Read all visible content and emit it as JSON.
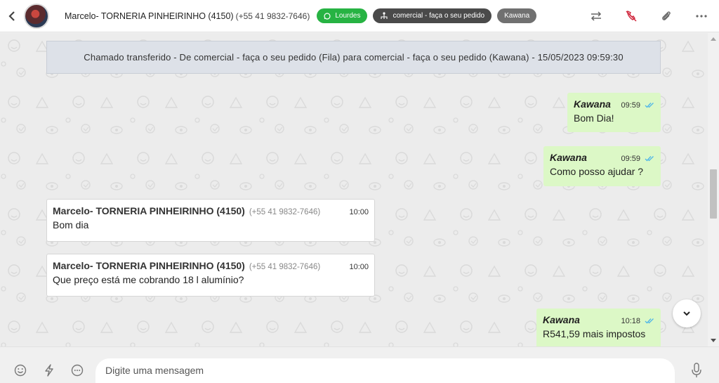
{
  "header": {
    "contact_name": "Marcelo- TORNERIA PINHEIRINHO (4150)",
    "contact_phone": "(+55 41 9832-7646)",
    "tags": {
      "channel": "Lourdes",
      "queue": "comercial - faça o seu pedido",
      "agent": "Kawana"
    }
  },
  "chat": {
    "notice": "Chamado transferido - De comercial - faça o seu pedido (Fila) para comercial - faça o seu pedido (Kawana) - 15/05/2023 09:59:30",
    "messages": [
      {
        "sender": "Kawana",
        "time": "09:59",
        "text": "Bom Dia!"
      },
      {
        "sender": "Kawana",
        "time": "09:59",
        "text": "Como posso ajudar ?"
      },
      {
        "sender": "Marcelo- TORNERIA PINHEIRINHO (4150)",
        "phone": "(+55 41 9832-7646)",
        "time": "10:00",
        "text": "Bom dia"
      },
      {
        "sender": "Marcelo- TORNERIA PINHEIRINHO (4150)",
        "phone": "(+55 41 9832-7646)",
        "time": "10:00",
        "text": "Que preço está me cobrando 18 l alumínio?"
      },
      {
        "sender": "Kawana",
        "time": "10:18",
        "text": "R541,59 mais impostos"
      }
    ]
  },
  "composer": {
    "placeholder": "Digite uma mensagem"
  },
  "icons": [
    "back-icon",
    "whatsapp-icon",
    "queue-icon",
    "transfer-icon",
    "end-call-icon",
    "attach-icon",
    "more-icon",
    "double-check-icon",
    "chevron-down-icon",
    "emoji-icon",
    "lightning-icon",
    "quick-reply-icon",
    "microphone-icon"
  ],
  "colors": {
    "outgoing_bubble": "#dcf8c6",
    "incoming_bubble": "#ffffff",
    "whatsapp_tag": "#27b343",
    "end_call_icon": "#d0273d",
    "read_ticks": "#4fb6e8"
  }
}
